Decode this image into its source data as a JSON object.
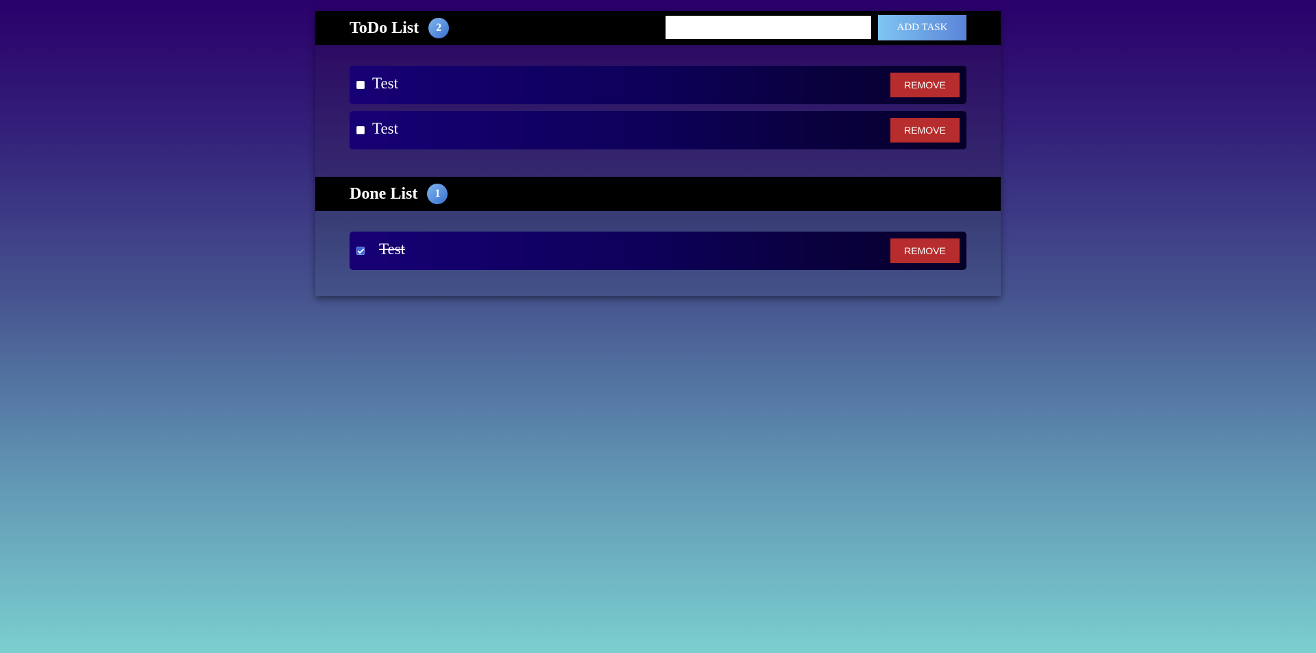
{
  "todo": {
    "title": "ToDo List",
    "count": "2",
    "input_value": "",
    "add_button_label": "ADD TASK",
    "tasks": [
      {
        "text": "Test",
        "checked": false,
        "remove_label": "REMOVE"
      },
      {
        "text": "Test",
        "checked": false,
        "remove_label": "REMOVE"
      }
    ]
  },
  "done": {
    "title": "Done List",
    "count": "1",
    "tasks": [
      {
        "text": "Test",
        "checked": true,
        "remove_label": "REMOVE"
      }
    ]
  },
  "colors": {
    "remove_button": "#b72c2c",
    "badge": "#4f85d8",
    "header": "#000000"
  },
  "icons": {
    "unchecked": "checkbox-unchecked-icon",
    "checked": "checkbox-checked-icon"
  }
}
